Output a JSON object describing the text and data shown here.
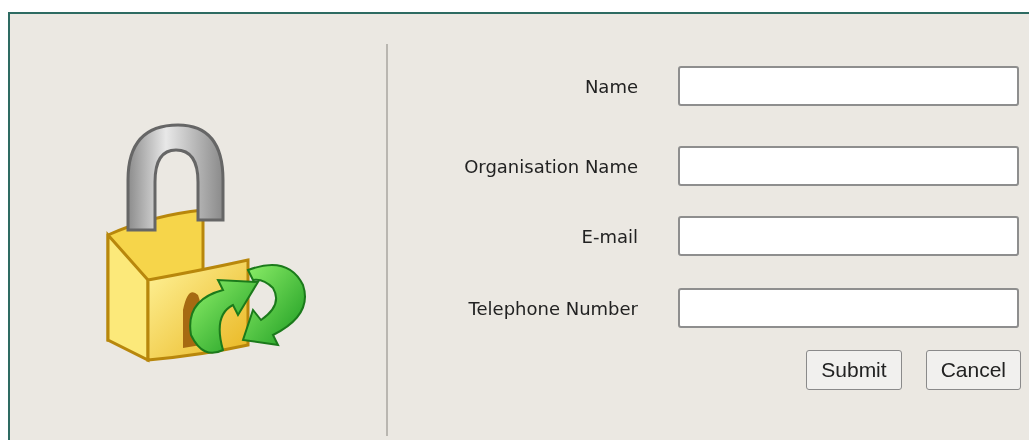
{
  "form": {
    "fields": [
      {
        "label": "Name"
      },
      {
        "label": "Organisation Name"
      },
      {
        "label": "E-mail"
      },
      {
        "label": "Telephone Number"
      }
    ],
    "buttons": [
      "Submit",
      "Cancel"
    ]
  }
}
